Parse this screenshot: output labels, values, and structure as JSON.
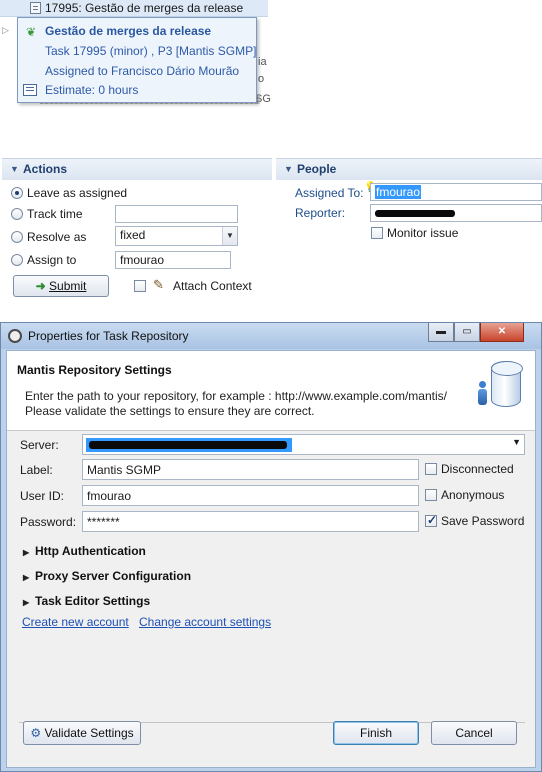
{
  "task_list": {
    "selected_task": "17995: Gestão de merges da release",
    "peek_texts": [
      "ia",
      "o",
      "SG"
    ]
  },
  "tooltip": {
    "title": "Gestão de merges da release",
    "task_line": "Task 17995 (minor) , P3  [Mantis SGMP]",
    "assigned_line": "Assigned to Francisco Dário Mourão",
    "estimate_line": "Estimate: 0 hours"
  },
  "actions": {
    "header": "Actions",
    "options": [
      {
        "label": "Leave as  assigned",
        "selected": true
      },
      {
        "label": "Track time",
        "selected": false
      },
      {
        "label": "Resolve as",
        "selected": false
      },
      {
        "label": "Assign to",
        "selected": false
      }
    ],
    "resolve_value": "fixed",
    "assign_value": "fmourao",
    "submit_label": "Submit",
    "attach_context_label": "Attach Context"
  },
  "people": {
    "header": "People",
    "assigned_to_label": "Assigned To:",
    "assigned_to_value": "fmourao",
    "reporter_label": "Reporter:",
    "monitor_issue_label": "Monitor issue"
  },
  "dialog": {
    "window_title": "Properties for Task Repository",
    "heading": "Mantis Repository Settings",
    "description_line1": "Enter the path to your repository, for example : http://www.example.com/mantis/",
    "description_line2": "Please validate the settings to ensure they are correct.",
    "server_label": "Server:",
    "label_label": "Label:",
    "label_value": "Mantis SGMP",
    "disconnected_label": "Disconnected",
    "userid_label": "User ID:",
    "userid_value": "fmourao",
    "anonymous_label": "Anonymous",
    "password_label": "Password:",
    "password_value": "*******",
    "save_password_label": "Save Password",
    "save_password_checked": true,
    "sections": [
      "Http Authentication",
      "Proxy Server Configuration",
      "Task Editor Settings"
    ],
    "create_account_link": "Create new account",
    "change_account_link": "Change account settings",
    "validate_button": "Validate Settings",
    "finish_button": "Finish",
    "cancel_button": "Cancel"
  }
}
